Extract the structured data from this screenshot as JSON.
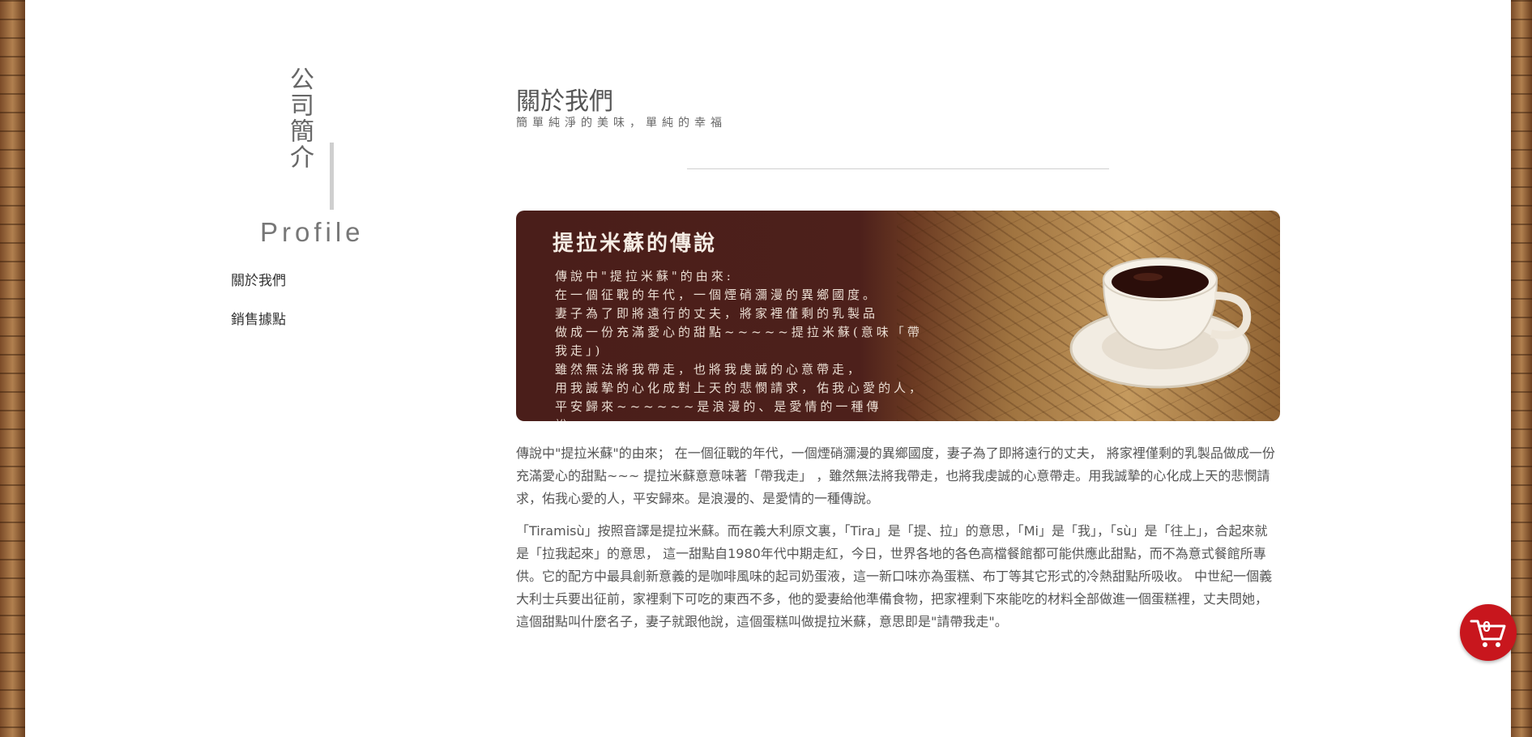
{
  "sidebar": {
    "title_vertical": "公司簡介",
    "title_en": "Profile",
    "links": [
      {
        "label": "關於我們"
      },
      {
        "label": "銷售據點"
      }
    ]
  },
  "main": {
    "title": "關於我們",
    "subtitle": "簡單純淨的美味，單純的幸福"
  },
  "banner": {
    "heading": "提拉米蘇的傳說",
    "text": "傳說中\"提拉米蘇\"的由來:\n在一個征戰的年代，一個煙硝瀰漫的異鄉國度。\n妻子為了即將遠行的丈夫，將家裡僅剩的乳製品\n做成一份充滿愛心的甜點~~~~~提拉米蘇(意味「帶我走」)\n雖然無法將我帶走，也將我虔誠的心意帶走，\n用我誠摯的心化成對上天的悲憫請求，佑我心愛的人，\n平安歸來~~~~~~是浪漫的、是愛情的一種傳說…………"
  },
  "paragraphs": [
    "傳說中\"提拉米蘇\"的由來； 在一個征戰的年代，一個煙硝瀰漫的異鄉國度，妻子為了即將遠行的丈夫， 將家裡僅剩的乳製品做成一份充滿愛心的甜點~~~ 提拉米蘇意意味著「帶我走」 ，雖然無法將我帶走，也將我虔誠的心意帶走。用我誠摯的心化成上天的悲憫請求，佑我心愛的人，平安歸來。是浪漫的、是愛情的一種傳說。",
    "「Tiramisù」按照音譯是提拉米蘇。而在義大利原文裏，「Tira」是「提、拉」的意思，「Mi」是「我」，「sù」是「往上」，合起來就是「拉我起來」的意思， 這一甜點自1980年代中期走紅，今日，世界各地的各色高檔餐館都可能供應此甜點，而不為意式餐館所專供。它的配方中最具創新意義的是咖啡風味的起司奶蛋液，這一新口味亦為蛋糕、布丁等其它形式的冷熱甜點所吸收。 中世紀一個義大利士兵要出征前，家裡剩下可吃的東西不多，他的愛妻給他準備食物，把家裡剩下來能吃的材料全部做進一個蛋糕裡，丈夫問她，這個甜點叫什麼名子，妻子就跟他說，這個蛋糕叫做提拉米蘇，意思即是\"請帶我走\"。"
  ],
  "cart": {
    "count": "0"
  },
  "colors": {
    "cart": "#c8161d",
    "banner_bg": "#4a1e1a"
  }
}
